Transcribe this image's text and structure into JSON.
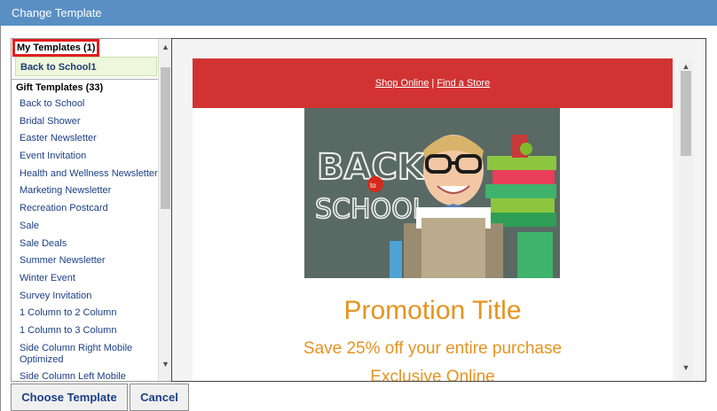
{
  "window": {
    "title": "Change Template"
  },
  "sidebar": {
    "my_templates": {
      "heading": "My Templates (1)",
      "items": [
        "Back to School1"
      ]
    },
    "gift_templates": {
      "heading": "Gift Templates (33)",
      "items": [
        "Back to School",
        "Bridal Shower",
        "Easter Newsletter",
        "Event Invitation",
        "Health and Wellness Newsletter",
        "Marketing Newsletter",
        "Recreation Postcard",
        "Sale",
        "Sale Deals",
        "Summer Newsletter",
        "Winter Event",
        "Survey Invitation",
        "1 Column to 2 Column",
        "1 Column to 3 Column",
        "Side Column Right Mobile Optimized",
        "Side Column Left Mobile"
      ]
    }
  },
  "preview": {
    "header_links": {
      "shop": "Shop Online",
      "separator": "|",
      "store": "Find a Store"
    },
    "hero": {
      "text_back": "BACK",
      "text_to": "to",
      "text_school": "SCHOOL"
    },
    "promo_title": "Promotion Title",
    "promo_subtitle": "Save 25% off your entire purchase",
    "promo_subtitle2": "Exclusive Online"
  },
  "buttons": {
    "choose": "Choose Template",
    "cancel": "Cancel"
  },
  "colors": {
    "titlebar": "#5a8fc4",
    "header_red": "#d13333",
    "promo_orange": "#e6931f",
    "highlight_red": "#e21d22"
  }
}
